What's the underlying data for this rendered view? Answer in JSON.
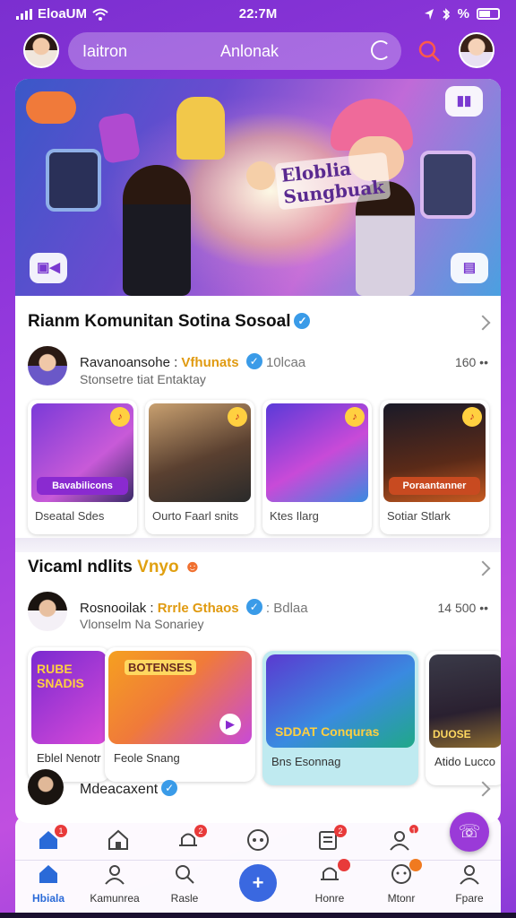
{
  "status_bar": {
    "carrier": "EloaUM",
    "time": "22:7M",
    "battery": "%"
  },
  "header": {
    "search_left": "Iaitron",
    "search_center": "Anlonak"
  },
  "hero": {
    "title_line1": "Eloblia",
    "title_line2": "Sungbuak"
  },
  "section1": {
    "title": "Rianm Komunitan Sotina Sosoal",
    "user_name": "Ravanoansohe :",
    "user_highlight": "Vfhunats",
    "user_extra": "10lcaa",
    "user_sub": "Stonsetre tiat Entaktay",
    "count": "160 ••",
    "tiles": [
      {
        "caption": "Dseatal Sdes",
        "banner": "Bavabilicons",
        "badge": "♪"
      },
      {
        "caption": "Ourto Faarl snits",
        "banner": "",
        "badge": "♪"
      },
      {
        "caption": "Ktes Ilarg",
        "banner": "",
        "badge": "♪"
      },
      {
        "caption": "Sotiar Stlark",
        "banner": "Poraantanner",
        "badge": "♪"
      }
    ]
  },
  "section2": {
    "title": "Vicaml ndlits",
    "title_accent": "Vnyo",
    "user_name": "Rosnooilak :",
    "user_highlight": "Rrrle Gthaos",
    "user_extra": ": Bdlaa",
    "user_sub": "Vlonselm Na Sonariey",
    "count": "14 500 ••",
    "tiles": [
      {
        "caption": "Eblel Nenotr",
        "overlay": "RUBE SNADIS"
      },
      {
        "caption": "Feole Snang",
        "overlay": "BOTENSES"
      },
      {
        "caption": "Bns Esonnag",
        "overlay": "SDDAT Conquras"
      },
      {
        "caption": "Atido Lucco",
        "overlay": "DUOSE"
      }
    ],
    "next_title": "Mdeacaxent"
  },
  "nav": {
    "top_badges": [
      "1",
      "2",
      "",
      "2",
      "",
      "1"
    ],
    "labels": [
      "Hbiala",
      "Kamunrea",
      "Rasle",
      "",
      "Honre",
      "Mtonr",
      "Fpare"
    ],
    "center_symbol": "+"
  },
  "colors": {
    "accent": "#3a68e0",
    "brand": "#9a3ad8",
    "verified": "#3a9be8"
  }
}
